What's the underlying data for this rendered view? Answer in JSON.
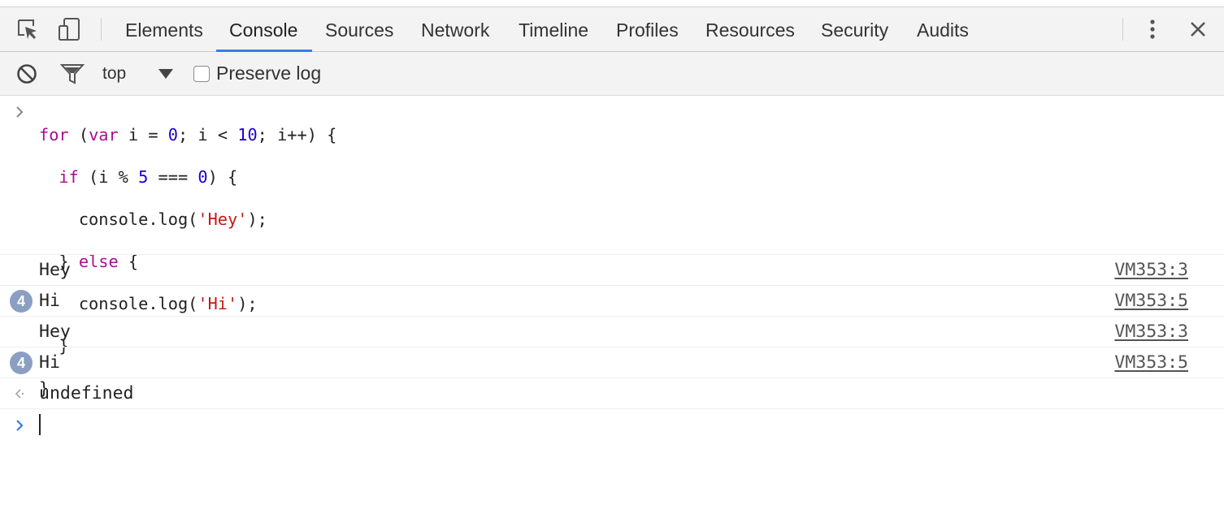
{
  "toolbar": {
    "tabs": [
      "Elements",
      "Console",
      "Sources",
      "Network",
      "Timeline",
      "Profiles",
      "Resources",
      "Security",
      "Audits"
    ],
    "active_tab": "Console",
    "icons": [
      "inspect-element-icon",
      "device-mode-icon",
      "more-options-icon",
      "close-icon"
    ]
  },
  "console_bar": {
    "context": "top",
    "preserve_log_label": "Preserve log",
    "preserve_log_checked": false,
    "icons": [
      "clear-console-icon",
      "filter-icon",
      "dropdown-arrow-icon"
    ]
  },
  "input_code": {
    "line1": {
      "kw_for": "for",
      "p1": " (",
      "kw_var": "var",
      "p2": " i = ",
      "n1": "0",
      "p3": "; i < ",
      "n2": "10",
      "p4": "; i++) {"
    },
    "line2": {
      "indent": "  ",
      "kw_if": "if",
      "p1": " (i % ",
      "n1": "5",
      "p2": " === ",
      "n2": "0",
      "p3": ") {"
    },
    "line3": {
      "p1": "    console.log(",
      "s1": "'Hey'",
      "p2": ");"
    },
    "line4": {
      "p1": "  } ",
      "kw_else": "else",
      "p2": " {"
    },
    "line5": {
      "p1": "    console.log(",
      "s1": "'Hi'",
      "p2": ");"
    },
    "line6": "  }",
    "line7": "}"
  },
  "log_entries": [
    {
      "message": "Hey",
      "count": "",
      "source": "VM353:3"
    },
    {
      "message": "Hi",
      "count": "4",
      "source": "VM353:5"
    },
    {
      "message": "Hey",
      "count": "",
      "source": "VM353:3"
    },
    {
      "message": "Hi",
      "count": "4",
      "source": "VM353:5"
    }
  ],
  "result": "undefined",
  "colors": {
    "keyword": "#aa0d91",
    "number": "#1c00cf",
    "string": "#c41a16",
    "accent": "#3a7ce6",
    "badge": "#8a9fc2"
  }
}
